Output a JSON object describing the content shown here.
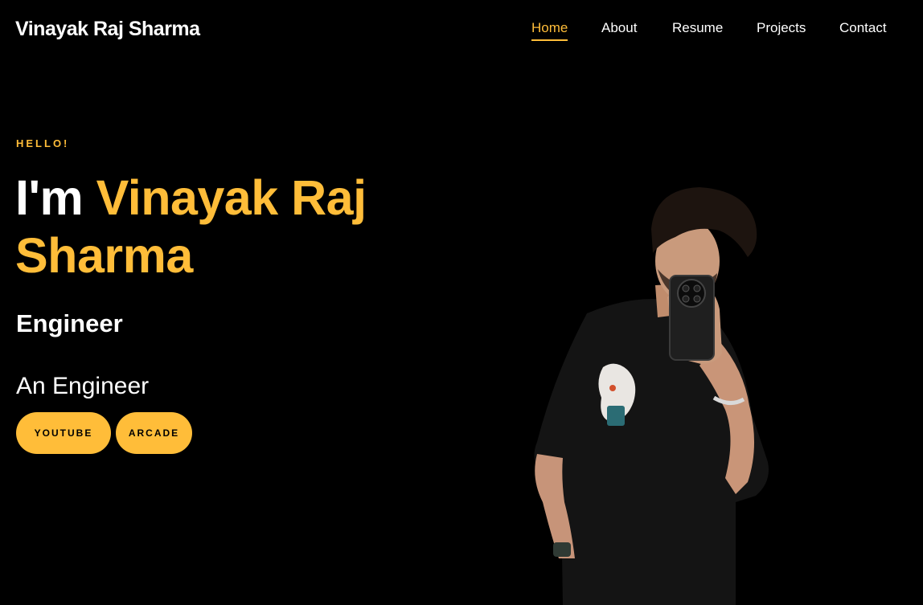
{
  "header": {
    "brand": "Vinayak Raj Sharma",
    "nav": [
      {
        "label": "Home",
        "active": true
      },
      {
        "label": "About",
        "active": false
      },
      {
        "label": "Resume",
        "active": false
      },
      {
        "label": "Projects",
        "active": false
      },
      {
        "label": "Contact",
        "active": false
      }
    ]
  },
  "hero": {
    "greeting": "HELLO!",
    "headline_prefix": "I'm",
    "headline_name": "Vinayak Raj Sharma",
    "role": "Engineer",
    "tagline": "An Engineer",
    "buttons": [
      {
        "label": "YOUTUBE"
      },
      {
        "label": "ARCADE"
      }
    ],
    "portrait_description": "person taking mirror selfie"
  },
  "colors": {
    "background": "#000000",
    "accent": "#ffbd39",
    "text": "#ffffff"
  }
}
